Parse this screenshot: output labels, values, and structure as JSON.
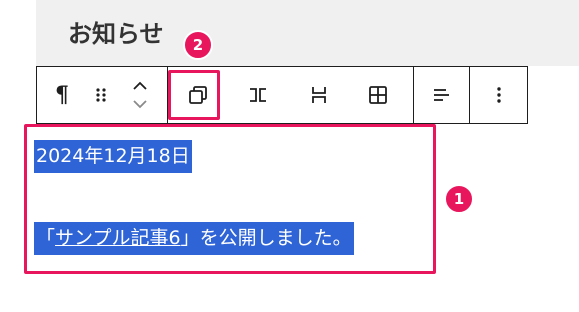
{
  "heading": {
    "text": "お知らせ"
  },
  "toolbar": {
    "paragraph_icon": "¶",
    "buttons": [
      {
        "name": "pilcrow-icon"
      },
      {
        "name": "drag-handle-icon"
      },
      {
        "name": "move-up-down-icon"
      },
      {
        "name": "group-icon"
      },
      {
        "name": "row-icon"
      },
      {
        "name": "stack-icon"
      },
      {
        "name": "grid-icon"
      },
      {
        "name": "align-left-icon"
      },
      {
        "name": "more-options-icon"
      }
    ]
  },
  "content": {
    "date": "2024年12月18日",
    "announcement": {
      "open_quote": "「",
      "link_text": "サンプル記事6",
      "close_quote": "」",
      "rest": "を公開しました。"
    }
  },
  "callouts": {
    "badge1": "1",
    "badge2": "2",
    "color": "#e8175d"
  },
  "colors": {
    "selection": "#2f64d6",
    "heading_bg": "#f0f0f0"
  }
}
